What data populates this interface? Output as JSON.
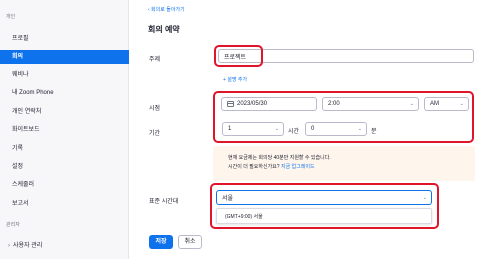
{
  "sidebar": {
    "section_personal": "개인",
    "items": [
      {
        "label": "프로필",
        "active": false
      },
      {
        "label": "회의",
        "active": true
      },
      {
        "label": "웨비나",
        "active": false
      },
      {
        "label": "내 Zoom Phone",
        "active": false
      },
      {
        "label": "개인 연락처",
        "active": false
      },
      {
        "label": "화이트보드",
        "active": false
      },
      {
        "label": "기록",
        "active": false
      },
      {
        "label": "설정",
        "active": false
      },
      {
        "label": "스케줄러",
        "active": false
      },
      {
        "label": "보고서",
        "active": false
      }
    ],
    "section_admin": "관리자",
    "admin_items": [
      {
        "label": "사용자 관리",
        "icon": "chevron-right-icon"
      }
    ]
  },
  "header": {
    "back_link": "‹ 회의로 돌아가기",
    "title": "회의 예약"
  },
  "form": {
    "topic_label": "주제",
    "topic_value": "프로젝트",
    "add_description": "+ 설명 추가",
    "when_label": "시점",
    "date_value": "2023/05/30",
    "time_value": "2:00",
    "ampm_value": "AM",
    "duration_label": "기간",
    "duration_hours": "1",
    "hours_unit": "시간",
    "duration_minutes": "0",
    "minutes_unit": "분",
    "notice_line1": "현재 요금제는 회의당 40분만 지원할 수 있습니다.",
    "notice_line2": "시간이 더 필요하신가요?",
    "notice_link": "지금 업그레이드",
    "timezone_label": "표준 시간대",
    "timezone_input": "서울",
    "timezone_option": "(GMT+9:00) 서울"
  },
  "buttons": {
    "save": "저장",
    "cancel": "취소"
  },
  "colors": {
    "accent": "#0e72ed",
    "highlight_box": "#e0142a",
    "notice_bg": "#fef6ed"
  }
}
